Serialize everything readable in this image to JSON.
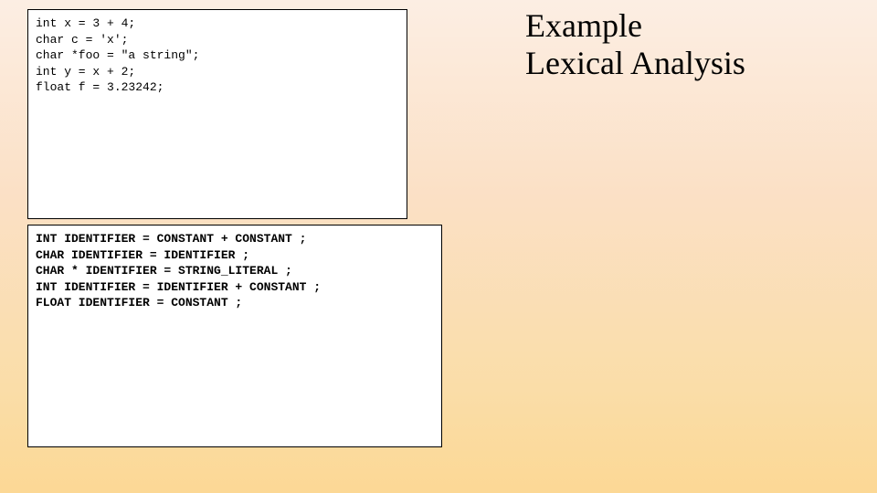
{
  "title_line1": "Example",
  "title_line2": "Lexical Analysis",
  "source_code": "int x = 3 + 4;\nchar c = 'x';\nchar *foo = \"a string\";\nint y = x + 2;\nfloat f = 3.23242;",
  "token_output": "INT IDENTIFIER = CONSTANT + CONSTANT ;\nCHAR IDENTIFIER = IDENTIFIER ;\nCHAR * IDENTIFIER = STRING_LITERAL ;\nINT IDENTIFIER = IDENTIFIER + CONSTANT ;\nFLOAT IDENTIFIER = CONSTANT ;"
}
